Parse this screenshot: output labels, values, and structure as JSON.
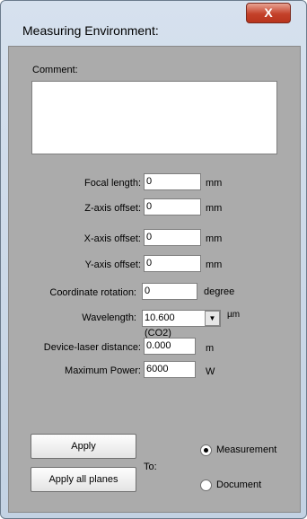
{
  "window": {
    "title": "Measuring Environment:",
    "close_glyph": "X"
  },
  "comment": {
    "label": "Comment:",
    "value": ""
  },
  "fields": {
    "focal_length": {
      "label": "Focal length:",
      "value": "0",
      "unit": "mm"
    },
    "z_axis_offset": {
      "label": "Z-axis offset:",
      "value": "0",
      "unit": "mm"
    },
    "x_axis_offset": {
      "label": "X-axis offset:",
      "value": "0",
      "unit": "mm"
    },
    "y_axis_offset": {
      "label": "Y-axis offset:",
      "value": "0",
      "unit": "mm"
    },
    "coordinate_rotation": {
      "label": "Coordinate rotation:",
      "value": "0",
      "unit": "degree"
    },
    "wavelength": {
      "label": "Wavelength:",
      "value": "10.600 (CO2)",
      "unit": "µm"
    },
    "device_laser_distance": {
      "label": "Device-laser distance:",
      "value": "0.000",
      "unit": "m"
    },
    "maximum_power": {
      "label": "Maximum Power:",
      "value": "6000",
      "unit": "W"
    }
  },
  "buttons": {
    "apply": "Apply",
    "apply_all": "Apply all planes"
  },
  "target": {
    "label": "To:",
    "options": [
      "Measurement",
      "Document"
    ],
    "selected": "Measurement"
  },
  "icons": {
    "close": "close-icon",
    "dropdown": "chevron-down-icon"
  }
}
